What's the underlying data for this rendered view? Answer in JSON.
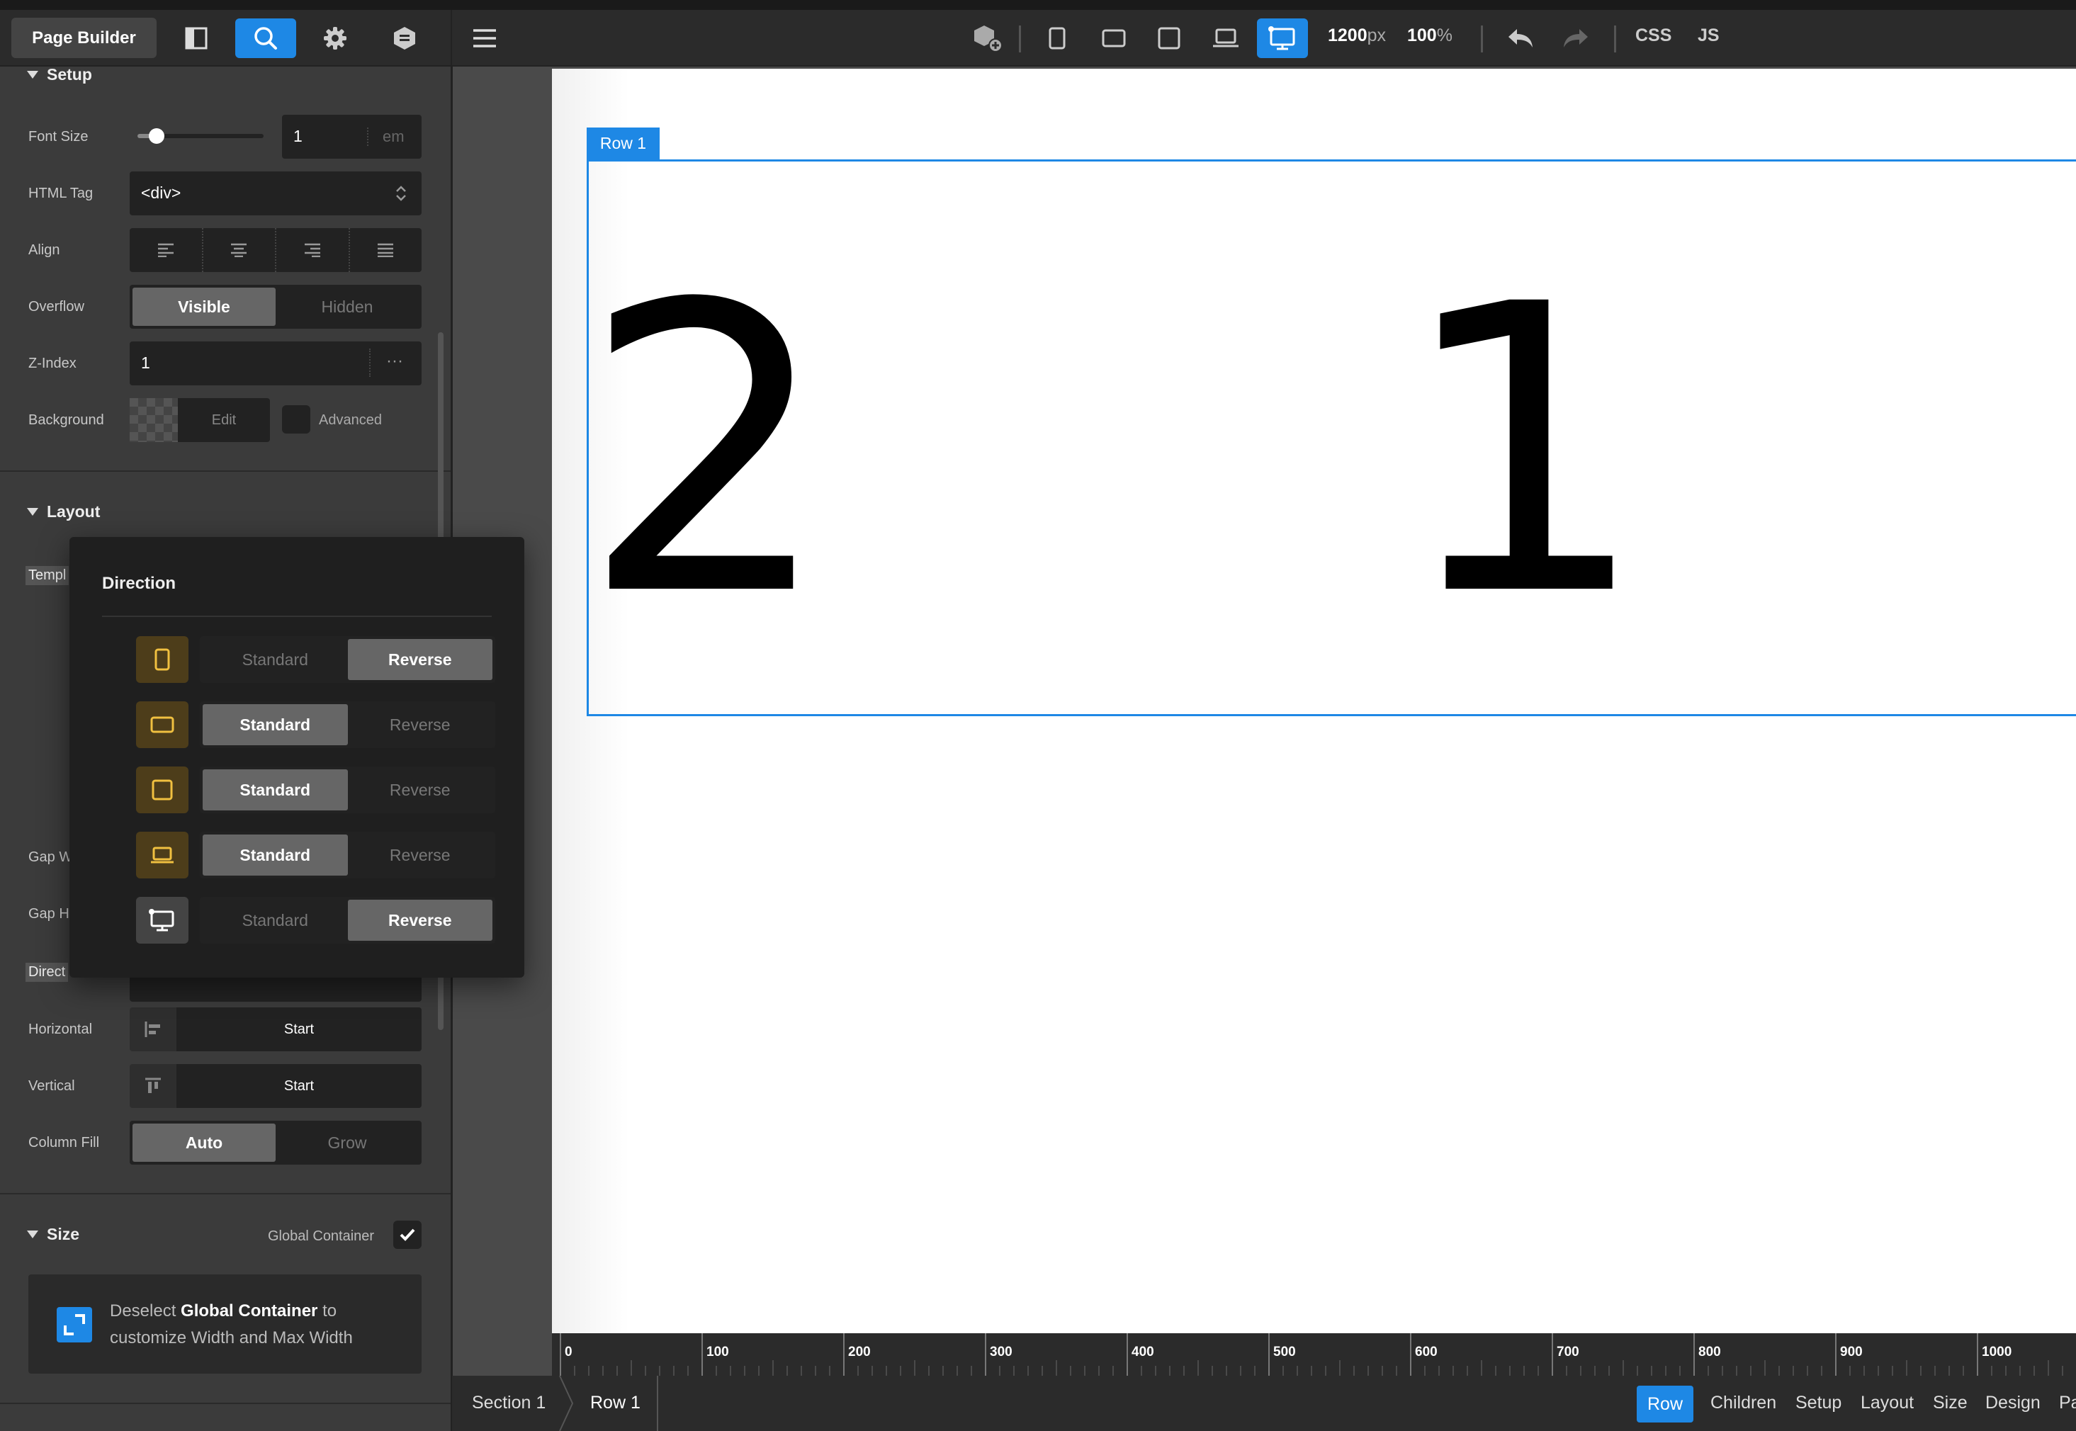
{
  "toolbar_left": {
    "page_builder_label": "Page Builder"
  },
  "setup": {
    "title": "Setup",
    "font_size": {
      "label": "Font Size",
      "value": "1",
      "unit": "em",
      "slider_fraction": 0.15
    },
    "html_tag": {
      "label": "HTML Tag",
      "value": "<div>"
    },
    "align": {
      "label": "Align"
    },
    "overflow": {
      "label": "Overflow",
      "options": [
        "Visible",
        "Hidden"
      ],
      "selected": "Visible"
    },
    "z_index": {
      "label": "Z-Index",
      "value": "1"
    },
    "background": {
      "label": "Background",
      "edit_label": "Edit",
      "advanced_label": "Advanced"
    }
  },
  "layout": {
    "title": "Layout",
    "template_label": "Templ",
    "gap_w_label": "Gap W",
    "gap_h_label": "Gap H",
    "direction_label": "Direct",
    "horizontal": {
      "label": "Horizontal",
      "value": "Start"
    },
    "vertical": {
      "label": "Vertical",
      "value": "Start"
    },
    "column_fill": {
      "label": "Column Fill",
      "options": [
        "Auto",
        "Grow"
      ],
      "selected": "Auto"
    }
  },
  "size": {
    "title": "Size",
    "global_container_label": "Global Container",
    "global_container_checked": true,
    "notice_pre": "Deselect ",
    "notice_bold": "Global Container",
    "notice_post": " to",
    "notice_line2": "customize Width and Max Width"
  },
  "popover": {
    "title": "Direction",
    "rows": [
      {
        "device": "tablet-portrait",
        "options": [
          "Standard",
          "Reverse"
        ],
        "selected": "Reverse"
      },
      {
        "device": "tablet-landscape",
        "options": [
          "Standard",
          "Reverse"
        ],
        "selected": "Standard"
      },
      {
        "device": "tablet-square",
        "options": [
          "Standard",
          "Reverse"
        ],
        "selected": "Standard"
      },
      {
        "device": "laptop",
        "options": [
          "Standard",
          "Reverse"
        ],
        "selected": "Standard"
      },
      {
        "device": "desktop",
        "options": [
          "Standard",
          "Reverse"
        ],
        "selected": "Reverse"
      }
    ]
  },
  "topbar": {
    "width_value": "1200",
    "width_unit": "px",
    "zoom_value": "100",
    "zoom_unit": "%",
    "css_label": "CSS",
    "js_label": "JS"
  },
  "canvas": {
    "row_tag": "Row 1",
    "col_a": "2",
    "col_b": "1"
  },
  "ruler": {
    "labels": [
      "0",
      "100",
      "200",
      "300",
      "400",
      "500",
      "600",
      "700",
      "800",
      "900",
      "1000"
    ]
  },
  "breadcrumb": {
    "items": [
      "Section 1",
      "Row 1"
    ]
  },
  "bottom_tabs": {
    "items": [
      "Row",
      "Children",
      "Setup",
      "Layout",
      "Size",
      "Design",
      "Pa"
    ],
    "active": "Row"
  },
  "colors": {
    "accent": "#1e88e5",
    "device_icon": "#f0c040",
    "panel_bg": "#3b3b3b",
    "toolbar_bg": "#2b2b2b"
  }
}
